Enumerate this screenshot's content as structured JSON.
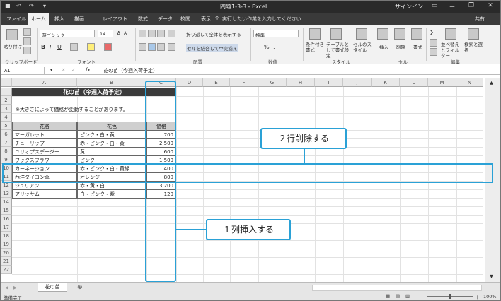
{
  "window": {
    "title": "問題1-3-3 - Excel",
    "signin": "サインイン",
    "minimize": "－",
    "restore": "❐",
    "close": "✕"
  },
  "quick_access": {
    "save_icon": "save-icon",
    "undo_icon": "undo-icon",
    "redo_icon": "redo-icon"
  },
  "tabs": [
    "ファイル",
    "ホーム",
    "挿入",
    "描画",
    "レイアウト",
    "数式",
    "データ",
    "校閲",
    "表示"
  ],
  "active_tab": "ホーム",
  "tell_me": "実行したい作業を入力してください",
  "share": "共有",
  "ribbon": {
    "clipboard": {
      "label": "クリップボード",
      "paste": "貼り付け"
    },
    "font": {
      "label": "フォント",
      "name": "游ゴシック",
      "size": "14",
      "bold": "B",
      "italic": "I",
      "underline": "U",
      "grow": "A",
      "shrink": "A"
    },
    "alignment": {
      "label": "配置",
      "wrap": "折り返して全体を表示する",
      "merge": "セルを結合して中央揃え"
    },
    "number": {
      "label": "数値",
      "format": "標準",
      "percent": "%",
      "comma": ","
    },
    "styles": {
      "label": "スタイル",
      "conditional": "条件付き書式",
      "table": "テーブルとして書式設定",
      "cell": "セルのスタイル"
    },
    "cells": {
      "label": "セル",
      "insert": "挿入",
      "delete": "削除",
      "format": "書式"
    },
    "editing": {
      "label": "編集",
      "sum": "Σ",
      "sort": "並べ替えとフィルター",
      "find": "検索と選択"
    }
  },
  "formula_bar": {
    "name_box": "A1",
    "fx": "fx",
    "content": "花の苗（今週入荷予定）"
  },
  "columns": [
    "A",
    "B",
    "C",
    "D",
    "E",
    "F",
    "G",
    "H",
    "I",
    "J",
    "K",
    "L",
    "M",
    "N"
  ],
  "rows": [
    "1",
    "2",
    "3",
    "4",
    "5",
    "6",
    "7",
    "8",
    "9",
    "10",
    "11",
    "12",
    "13",
    "14",
    "15",
    "16",
    "17",
    "18",
    "19",
    "20",
    "21",
    "22"
  ],
  "sheet": {
    "title": "花の苗（今週入荷予定）",
    "note": "※大きさによって価格が変動することがあります。",
    "headers": [
      "花名",
      "花色",
      "価格"
    ],
    "data": [
      [
        "マーガレット",
        "ピンク・白・黄",
        "700"
      ],
      [
        "チューリップ",
        "赤・ピンク・白・黄",
        "2,500"
      ],
      [
        "ユリオプスデージー",
        "黄",
        "600"
      ],
      [
        "ワックスフラワー",
        "ピンク",
        "1,500"
      ],
      [
        "カーネーション",
        "赤・ピンク・白・黄緑",
        "1,400"
      ],
      [
        "西洋ダイコン草",
        "オレンジ",
        "800"
      ],
      [
        "ジュリアン",
        "赤・黄・白",
        "3,200"
      ],
      [
        "アリッサム",
        "白・ピンク・紫",
        "120"
      ]
    ]
  },
  "callouts": {
    "delete_rows": "２行削除する",
    "insert_column": "１列挿入する"
  },
  "sheet_tabs": {
    "name": "花の苗",
    "add": "⊕"
  },
  "status": {
    "ready": "準備完了",
    "zoom": "100%"
  }
}
